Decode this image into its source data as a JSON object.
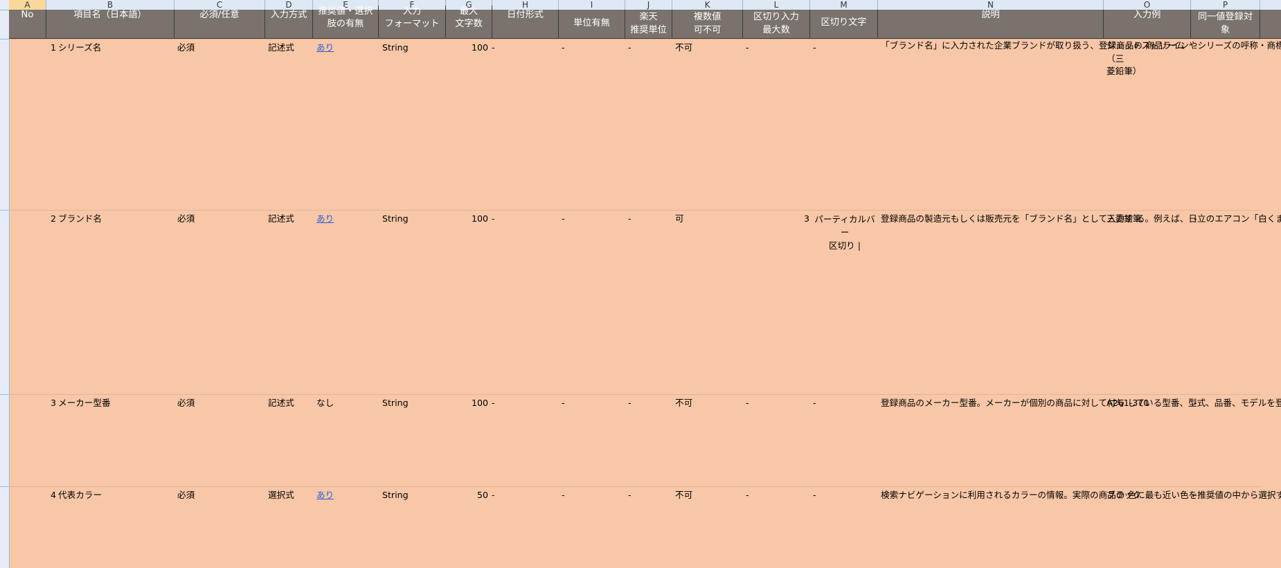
{
  "column_letters": [
    "A",
    "B",
    "C",
    "D",
    "E",
    "F",
    "G",
    "H",
    "I",
    "J",
    "K",
    "L",
    "M",
    "N",
    "O",
    "P"
  ],
  "headers": {
    "no": "No",
    "item_name": "項目名（日本語）",
    "required": "必須/任意",
    "input_method": "入力方式",
    "recommended": "推奨値・選択\n肢の有無",
    "format": "入力\nフォーマット",
    "max_chars": "最大\n文字数",
    "date_format": "日付形式",
    "unit": "単位有無",
    "rakuten_unit": "楽天\n推奨単位",
    "multi_value": "複数値\n可不可",
    "sep_max": "区切り入力\n最大数",
    "sep_char": "区切り文字",
    "description": "説明",
    "example": "入力例",
    "same_value": "同一値登録対\n象"
  },
  "rows": [
    {
      "no": "1",
      "name": "シリーズ名",
      "required": "必須",
      "method": "記述式",
      "recommended": "あり",
      "recommended_link": true,
      "format": "String",
      "max": "100",
      "date": "-",
      "unit": "-",
      "rakuten_unit": "-",
      "multi": "不可",
      "sep_max": "-",
      "sep_char": "-",
      "description": "「ブランド名」に入力された企業ブランドが取り扱う、登録商品の\n商品ラインやシリーズの呼称・商標。例えば、日立のエアコン白\nくまくんのシリーズ名は「白くまくん」となる。\nシリーズ名が一般名称であったり、他メーカー・企業に同一名の\nシリーズ名がある場合、シリーズ名（ブランド名）の表記を推\n奨。\nまた、その場合には、シリーズ名と「（」（全角カッコ）の間にス\nペースは設けない。\n例）アーモンド（明治）\n店舗様オリジナル商品でも商品ラインやシリーズの呼称・商標\nが存在する場合は、その呼称を記載。\nノーブランド商品など該当しない商品については、必須入力時\nには「-」(半角ハイフン)を、任意入力時には空欄とする。",
      "example": "ジェットストリーム（三\n菱鉛筆）",
      "same": "-"
    },
    {
      "no": "2",
      "name": "ブランド名",
      "required": "必須",
      "method": "記述式",
      "recommended": "あり",
      "recommended_link": true,
      "format": "String",
      "max": "100",
      "date": "-",
      "unit": "-",
      "rakuten_unit": "-",
      "multi": "可",
      "sep_max": "3",
      "sep_char": "パーティカルバー\n区切り |",
      "description": "登録商品の製造元もしくは販売元を「ブランド名」として入力す\nる。例えば、日立のエアコン「白くまくん」のブランド名は「日立」と\nなる。複数のブランドのコラボ商品の場合や、製造・販売してい\nる会社が異なる場合は複数の「ブランド名」を入力し、「ブランド\n名」間を区切り文字で区切る。楽天指定の区切り文字(「|」半\n角バーティカルバー)を利用した場合は、商品ページ上で分割さ\nれて表示される。\n自社ブランド商品の場合には、店舗名もしくは店舗様の法人\n格を除いた運営会社名を「ブランド名」として入力する。もし、店\n舗名や社名ではなく企業ブランドとして打ち出している呼称・商\n標がある場合は、そちらを入力する。\n「ブランド名」不明や「ブランド名」の入力が該当しない商品につ\nいては、必須入力時には「-」(半角ハイフン)を、任意入力時に\nは空欄とする。",
      "example": "三菱鉛筆",
      "same": "-"
    },
    {
      "no": "3",
      "name": "メーカー型番",
      "required": "必須",
      "method": "記述式",
      "recommended": "なし",
      "recommended_link": false,
      "format": "String",
      "max": "100",
      "date": "-",
      "unit": "-",
      "rakuten_unit": "-",
      "multi": "不可",
      "sep_max": "-",
      "sep_char": "-",
      "description": "登録商品のメーカー型番。メーカーが個別の商品に対して付与\nしている型番、型式、品番、モデルを登録する。出品商品に型\n番が存在する場合は、型番を記載する。\n店舗様オリジナル商品で型番が存在する場合は、型番を入\n力。型番含めいずれも存在しない場合や「メーカー型番」の入\n力が該当しない商品は、必須入力時には「-」(半角ハイフン)\nを、任意入力時には空欄とする。",
      "example": "A261-370",
      "same": "-"
    },
    {
      "no": "4",
      "name": "代表カラー",
      "required": "必須",
      "method": "選択式",
      "recommended": "あり",
      "recommended_link": true,
      "format": "String",
      "max": "50",
      "date": "-",
      "unit": "-",
      "rakuten_unit": "-",
      "multi": "不可",
      "sep_max": "-",
      "sep_char": "-",
      "description": "検索ナビゲーションに利用されるカラーの情報。実際の商品の\n色に最も近い色を推奨値の中から選択する。複数の「代表カ\nラー」が該当する場合は、マルチカラーを選択。\n別項目の「カラー」にはメーカーが指定する色名称を入力。メー\nカー指定カラーが「クリムゾンレッド」の場合、「カラー」は「クリムゾ\nンレッド」、「代表カラー」は推奨値にある「レッド」となる。「代表",
      "example": "ブラック",
      "same": "-"
    }
  ]
}
